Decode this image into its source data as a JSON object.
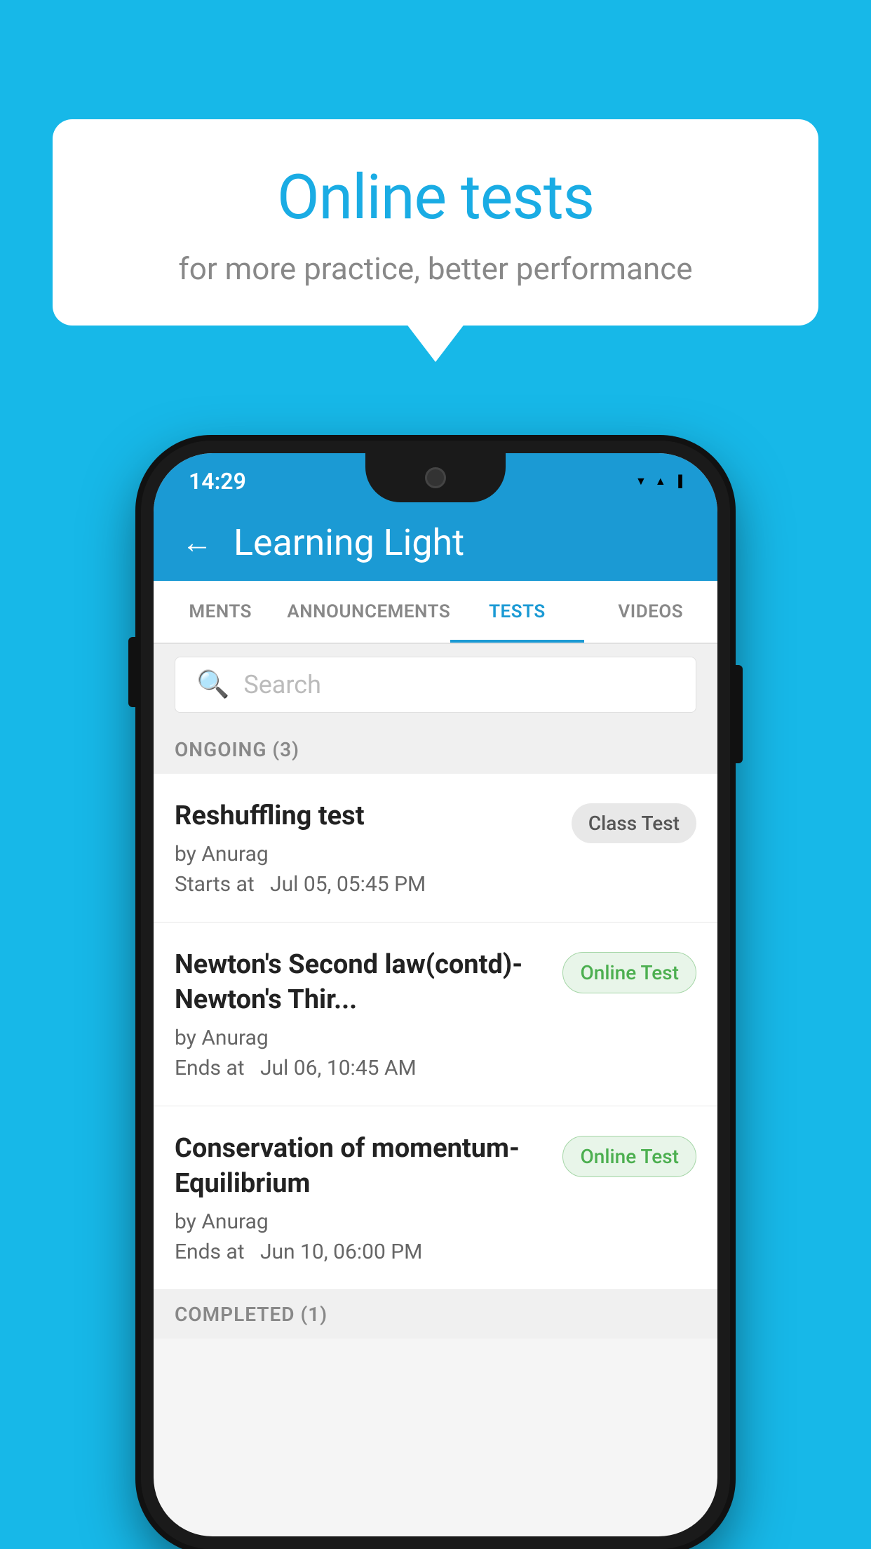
{
  "background_color": "#17b8e8",
  "bubble": {
    "title": "Online tests",
    "subtitle": "for more practice, better performance"
  },
  "status_bar": {
    "time": "14:29",
    "icons": [
      "wifi",
      "signal",
      "battery"
    ]
  },
  "header": {
    "title": "Learning Light",
    "back_label": "←"
  },
  "tabs": [
    {
      "label": "MENTS",
      "active": false
    },
    {
      "label": "ANNOUNCEMENTS",
      "active": false
    },
    {
      "label": "TESTS",
      "active": true
    },
    {
      "label": "VIDEOS",
      "active": false
    }
  ],
  "search": {
    "placeholder": "Search"
  },
  "ongoing_section": {
    "label": "ONGOING (3)"
  },
  "tests": [
    {
      "name": "Reshuffling test",
      "author": "by Anurag",
      "time_label": "Starts at",
      "time": "Jul 05, 05:45 PM",
      "badge": "Class Test",
      "badge_type": "class"
    },
    {
      "name": "Newton's Second law(contd)-Newton's Thir...",
      "author": "by Anurag",
      "time_label": "Ends at",
      "time": "Jul 06, 10:45 AM",
      "badge": "Online Test",
      "badge_type": "online"
    },
    {
      "name": "Conservation of momentum-Equilibrium",
      "author": "by Anurag",
      "time_label": "Ends at",
      "time": "Jun 10, 06:00 PM",
      "badge": "Online Test",
      "badge_type": "online"
    }
  ],
  "completed_section": {
    "label": "COMPLETED (1)"
  }
}
